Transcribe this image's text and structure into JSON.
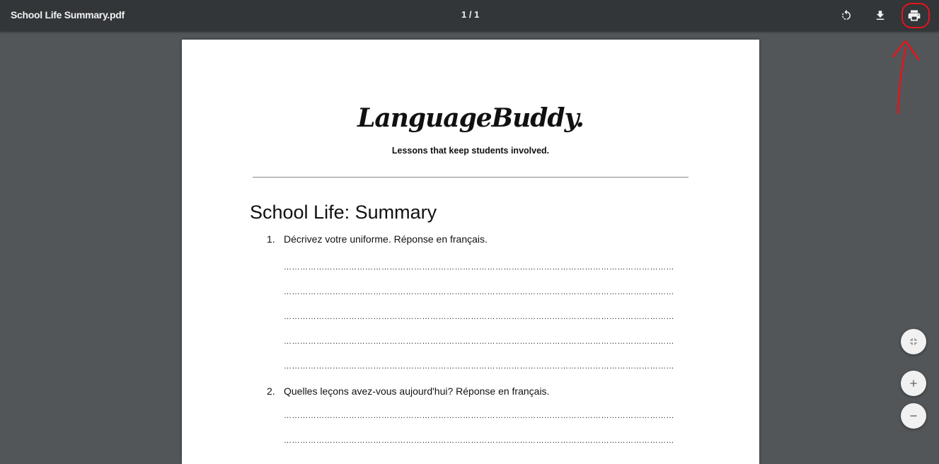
{
  "toolbar": {
    "file_title": "School Life Summary.pdf",
    "page_indicator": "1 / 1",
    "icons": [
      "rotate-icon",
      "download-icon",
      "print-icon"
    ]
  },
  "annotation": {
    "color": "#e4141b",
    "target": "print-button"
  },
  "document": {
    "logo_text": "LanguageBuddy.",
    "tagline": "Lessons that keep students involved.",
    "title": "School Life: Summary",
    "questions": [
      {
        "number": "1.",
        "text": "Décrivez votre uniforme. Réponse en français."
      },
      {
        "number": "2.",
        "text": "Quelles leçons avez-vous aujourd'hui? Réponse en français."
      }
    ]
  },
  "zoom_controls": {
    "icons": [
      "fit-to-page-icon",
      "zoom-in-icon",
      "zoom-out-icon"
    ]
  },
  "colors": {
    "toolbar_bg": "#323639",
    "viewer_bg": "#525659",
    "page_bg": "#ffffff"
  }
}
